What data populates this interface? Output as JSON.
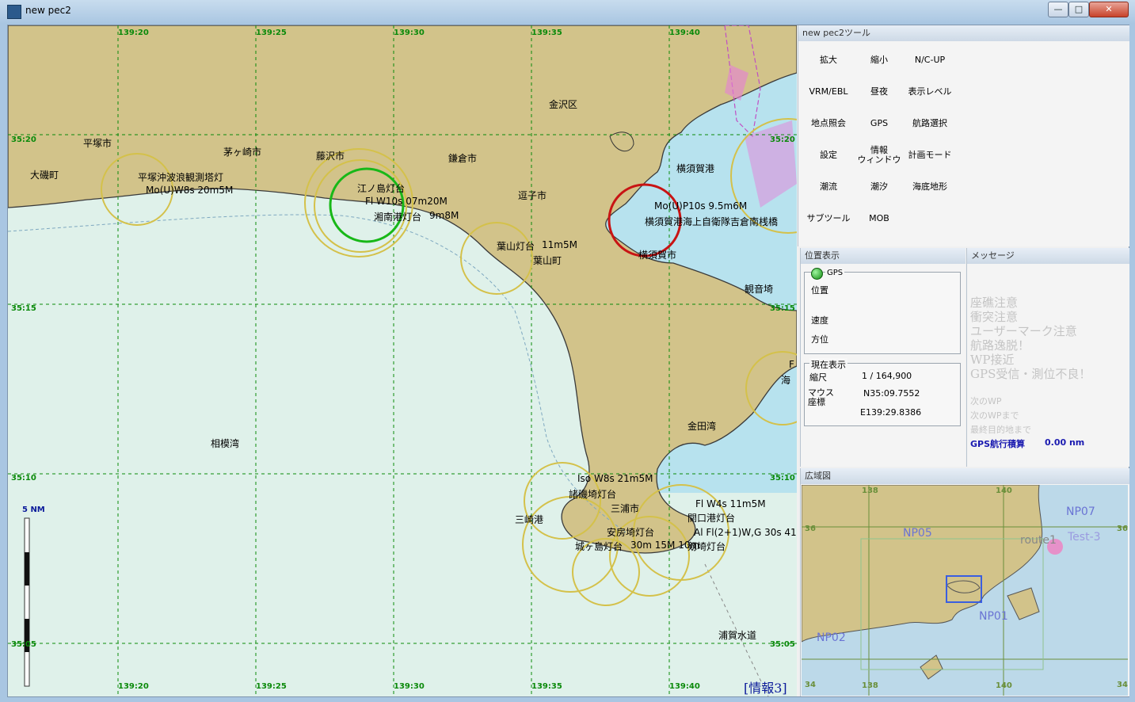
{
  "window": {
    "title": "new pec2",
    "buttons": {
      "minimize": "—",
      "maximize": "□",
      "close": "✕"
    }
  },
  "chart": {
    "grid_top": [
      "139:20",
      "139:25",
      "139:30",
      "139:35",
      "139:40"
    ],
    "grid_bottom": [
      "139:20",
      "139:25",
      "139:30",
      "139:35",
      "139:40"
    ],
    "grid_left": [
      "35:20",
      "35:15",
      "35:10",
      "35:05"
    ],
    "grid_right": [
      "35:20",
      "35:15",
      "35:10",
      "35:05"
    ],
    "places": {
      "kanazawa": "金沢区",
      "hiratsuka": "平塚市",
      "chigasaki": "茅ヶ崎市",
      "fujisawa": "藤沢市",
      "kamakura": "鎌倉市",
      "oiso": "大磯町",
      "zushi": "逗子市",
      "yokosuka_port": "横須賀港",
      "yokosuka_city": "横須賀市",
      "hayama": "葉山町",
      "kannonzaki": "観音埼",
      "sagami_bay": "相模湾",
      "kaneda_bay": "金田湾",
      "misaki_port": "三崎港",
      "miura_city": "三浦市",
      "uraga_channel": "浦賀水道"
    },
    "lights": {
      "hiratsuka_light": "平塚沖波浪観測塔灯",
      "hiratsuka_char": "Mo(U)W8s 20m5M",
      "enoshima_light": "江ノ島灯台",
      "enoshima_char": "Fl W10s 07m20M",
      "shonan_light": "湘南港灯台",
      "shonan_char": "9m8M",
      "hayama_light": "葉山灯台",
      "hayama_char": "11m5M",
      "yokosuka_char": "Mo(U)P10s 9.5m6M",
      "yokosuka_light": "横須賀港海上自衛隊吉倉南桟橋",
      "jogashima_char": "Iso W8s 21m5M",
      "jogashima_light": "諸磯埼灯台",
      "awasaki_light": "安房埼灯台",
      "jogashima2": "城ヶ島灯台",
      "jogashima2_char": "30m 15M 10m",
      "tsurugi_light": "剱埼灯台",
      "misaki_port_light": "関口港灯台",
      "misaki_char": "Fl W4s 11m5M",
      "tsurugi_char": "Al Fl(2+1)W,G 30s 41m",
      "kannon_right": "F",
      "hayama_right": "海"
    },
    "scale": "5 NM",
    "info_label": "[情報3]"
  },
  "tools": {
    "title": "new pec2ツール",
    "buttons": [
      [
        "拡大",
        "縮小",
        "N/C-UP"
      ],
      [
        "VRM/EBL",
        "昼夜",
        "表示レベル"
      ],
      [
        "地点照会",
        "GPS",
        "航路選択"
      ],
      [
        "設定",
        "情報\nウィンドウ",
        "計画モード"
      ],
      [
        "潮流",
        "潮汐",
        "海底地形"
      ],
      [
        "サブツール",
        "MOB",
        ""
      ]
    ]
  },
  "position": {
    "title": "位置表示",
    "gps_label": "GPS",
    "pos_label": "位置",
    "speed_label": "速度",
    "heading_label": "方位",
    "current_title": "現在表示",
    "scale_label": "縮尺",
    "scale_value": "1 / 164,900",
    "mouse_label": "マウス\n座標",
    "lat": "N35:09.7552",
    "lon": "E139:29.8386"
  },
  "messages": {
    "title": "メッセージ",
    "warnings": [
      "座礁注意",
      "衝突注意",
      "ユーザーマーク注意",
      "航路逸脱！",
      "WP接近",
      "GPS受信・測位不良！"
    ],
    "next_wp": "次のWP",
    "to_next_wp": "次のWPまで",
    "to_final": "最終目的地まで",
    "gps_total_label": "GPS航行積算",
    "gps_total_value": "0.00 nm"
  },
  "overview": {
    "title": "広域図",
    "grid_top": [
      "138",
      "140"
    ],
    "grid_left": [
      "36",
      "34"
    ],
    "grid_right": [
      "36",
      "34"
    ],
    "grid_bottom": [
      "138",
      "140"
    ],
    "areas": [
      "NP07",
      "NP05",
      "NP01",
      "NP02"
    ],
    "route_label": "route1",
    "test_label": "Test-3"
  },
  "colors": {
    "land": "#d2c38a",
    "deep": "#dff1ea",
    "shallow": "#b7e2ee",
    "grid": "#0b8a0b"
  }
}
